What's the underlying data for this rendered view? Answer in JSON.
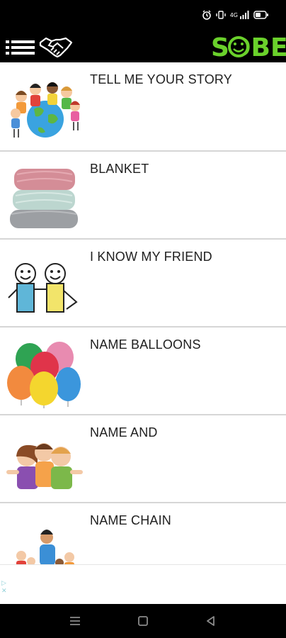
{
  "status_bar": {
    "icons": [
      "alarm-icon",
      "vibrate-icon",
      "signal-icon",
      "battery-icon"
    ],
    "signal_text": "4G"
  },
  "app_bar": {
    "menu_icon": "menu-icon",
    "handshake_icon": "handshake-icon",
    "logo_text": "SOBE",
    "brand_color": "#6ad12b"
  },
  "list": {
    "items": [
      {
        "title": "TELL ME YOUR STORY",
        "image": "children-around-globe"
      },
      {
        "title": "BLANKET",
        "image": "folded-blankets"
      },
      {
        "title": "I KNOW MY FRIEND",
        "image": "two-stick-friends"
      },
      {
        "title": "NAME BALLOONS",
        "image": "colorful-balloons"
      },
      {
        "title": "NAME AND",
        "image": "three-kids-thumbs-up"
      },
      {
        "title": "NAME CHAIN",
        "image": "kids-circle-with-teacher"
      }
    ]
  },
  "nav_bar": {
    "buttons": [
      "recents-button",
      "home-button",
      "back-button"
    ]
  }
}
